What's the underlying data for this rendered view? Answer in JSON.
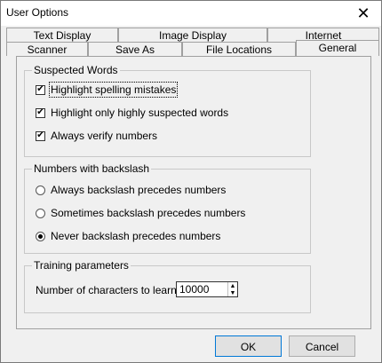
{
  "window": {
    "title": "User Options"
  },
  "tabs_row1": [
    "Text Display",
    "Image Display",
    "Internet"
  ],
  "tabs_row2": [
    "Scanner",
    "Save As",
    "File Locations",
    "General"
  ],
  "active_tab": "General",
  "suspected_words": {
    "label": "Suspected Words",
    "items": [
      {
        "label": "Highlight spelling mistakes",
        "checked": true
      },
      {
        "label": "Highlight only highly suspected words",
        "checked": true
      },
      {
        "label": "Always verify numbers",
        "checked": true
      }
    ]
  },
  "numbers_backslash": {
    "label": "Numbers with backslash",
    "items": [
      {
        "label": "Always backslash precedes numbers",
        "selected": false
      },
      {
        "label": "Sometimes backslash precedes numbers",
        "selected": false
      },
      {
        "label": "Never backslash precedes numbers",
        "selected": true
      }
    ]
  },
  "training": {
    "label": "Training parameters",
    "field_label": "Number of characters to learn:",
    "value": "10000"
  },
  "buttons": {
    "ok": "OK",
    "cancel": "Cancel"
  }
}
